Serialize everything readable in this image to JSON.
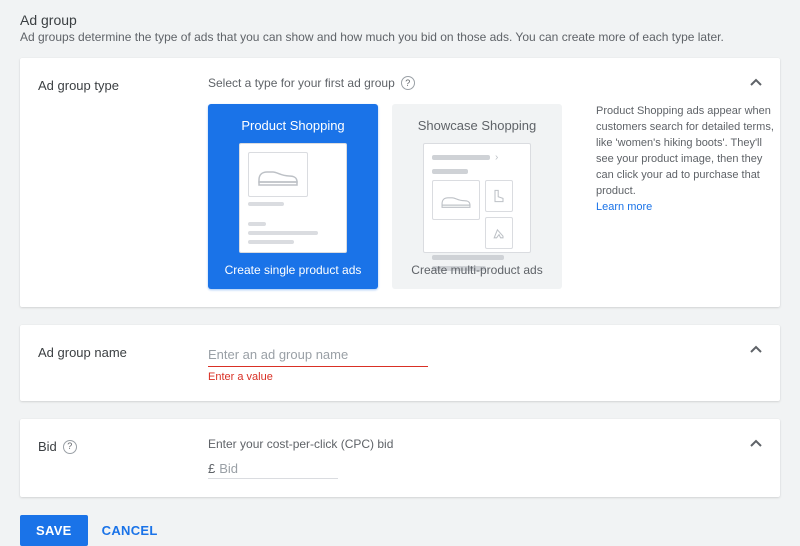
{
  "header": {
    "title": "Ad group",
    "subtitle": "Ad groups determine the type of ads that you can show and how much you bid on those ads. You can create more of each type later."
  },
  "adGroupType": {
    "label": "Ad group type",
    "instruction": "Select a type for your first ad group",
    "options": [
      {
        "title": "Product Shopping",
        "subtitle": "Create single product ads",
        "selected": true
      },
      {
        "title": "Showcase Shopping",
        "subtitle": "Create multi-product ads",
        "selected": false
      }
    ],
    "info": "Product Shopping ads appear when customers search for detailed terms, like 'women's hiking boots'. They'll see your product image, then they can click your ad to purchase that product.",
    "learnMore": "Learn more"
  },
  "adGroupName": {
    "label": "Ad group name",
    "placeholder": "Enter an ad group name",
    "value": "",
    "errorText": "Enter a value"
  },
  "bid": {
    "label": "Bid",
    "instruction": "Enter your cost-per-click (CPC) bid",
    "currency": "£",
    "placeholder": "Bid",
    "value": ""
  },
  "actions": {
    "save": "SAVE",
    "cancel": "CANCEL"
  }
}
